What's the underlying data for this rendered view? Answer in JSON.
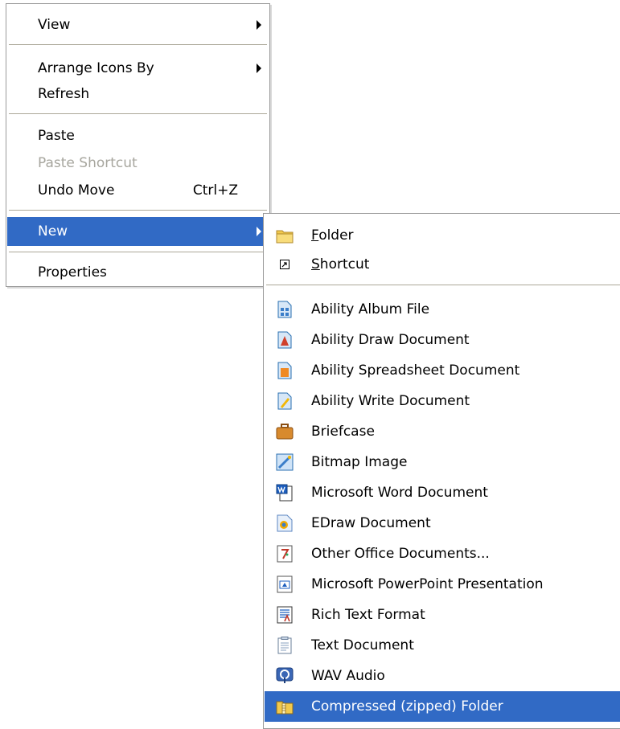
{
  "main_menu": {
    "view": "View",
    "arrange_icons_by": "Arrange Icons By",
    "refresh": "Refresh",
    "paste": "Paste",
    "paste_shortcut": "Paste Shortcut",
    "undo_move": "Undo Move",
    "undo_move_shortcut": "Ctrl+Z",
    "new": "New",
    "properties": "Properties"
  },
  "new_submenu": {
    "folder": {
      "accel": "F",
      "rest": "older"
    },
    "shortcut": {
      "accel": "S",
      "rest": "hortcut"
    },
    "items": [
      {
        "label": "Ability Album File",
        "icon": "ability-album-icon"
      },
      {
        "label": "Ability Draw Document",
        "icon": "ability-draw-icon"
      },
      {
        "label": "Ability Spreadsheet Document",
        "icon": "ability-spreadsheet-icon"
      },
      {
        "label": "Ability Write Document",
        "icon": "ability-write-icon"
      },
      {
        "label": "Briefcase",
        "icon": "briefcase-icon"
      },
      {
        "label": "Bitmap Image",
        "icon": "bitmap-icon"
      },
      {
        "label": "Microsoft Word Document",
        "icon": "word-document-icon"
      },
      {
        "label": "EDraw Document",
        "icon": "edraw-icon"
      },
      {
        "label": "Other Office Documents...",
        "icon": "office-documents-icon"
      },
      {
        "label": "Microsoft PowerPoint Presentation",
        "icon": "powerpoint-icon"
      },
      {
        "label": "Rich Text Format",
        "icon": "rtf-icon"
      },
      {
        "label": "Text Document",
        "icon": "text-document-icon"
      },
      {
        "label": "WAV Audio",
        "icon": "wav-audio-icon"
      },
      {
        "label": "Compressed (zipped) Folder",
        "icon": "zip-folder-icon"
      }
    ]
  },
  "colors": {
    "highlight": "#316ac5",
    "disabled_text": "#a7a69e",
    "separator": "#aca899"
  }
}
